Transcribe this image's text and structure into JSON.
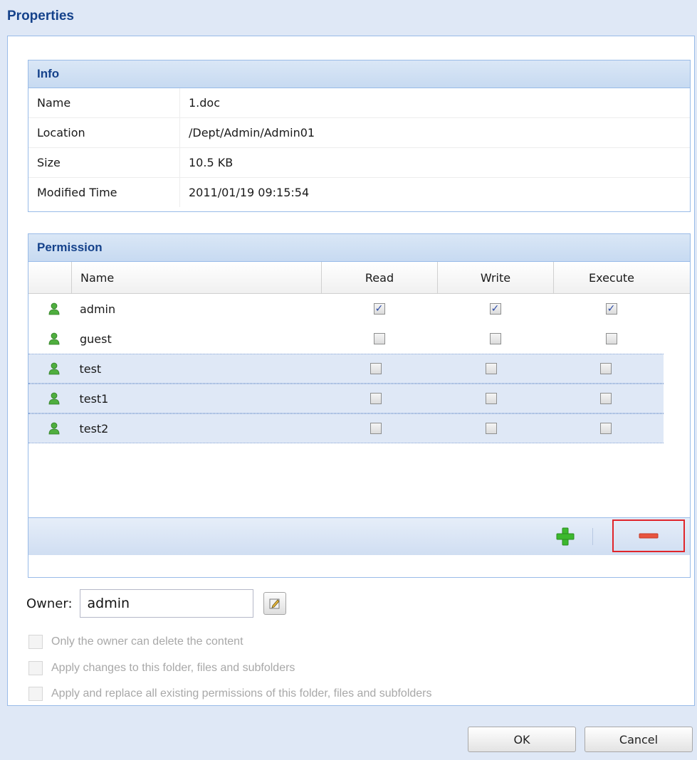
{
  "window": {
    "title": "Properties"
  },
  "info": {
    "header": "Info",
    "rows": [
      {
        "label": "Name",
        "value": "1.doc"
      },
      {
        "label": "Location",
        "value": "/Dept/Admin/Admin01"
      },
      {
        "label": "Size",
        "value": "10.5 KB"
      },
      {
        "label": "Modified Time",
        "value": "2011/01/19 09:15:54"
      }
    ]
  },
  "permission": {
    "header": "Permission",
    "columns": {
      "name": "Name",
      "read": "Read",
      "write": "Write",
      "execute": "Execute"
    },
    "rows": [
      {
        "name": "admin",
        "read": true,
        "write": true,
        "execute": true,
        "selected": false,
        "icon": "user-icon"
      },
      {
        "name": "guest",
        "read": false,
        "write": false,
        "execute": false,
        "selected": false,
        "icon": "user-icon"
      },
      {
        "name": "test",
        "read": false,
        "write": false,
        "execute": false,
        "selected": true,
        "icon": "user-icon"
      },
      {
        "name": "test1",
        "read": false,
        "write": false,
        "execute": false,
        "selected": true,
        "icon": "user-icon"
      },
      {
        "name": "test2",
        "read": false,
        "write": false,
        "execute": false,
        "selected": true,
        "icon": "user-icon"
      }
    ],
    "toolbar": {
      "add_icon": "plus-icon",
      "remove_icon": "minus-icon"
    }
  },
  "owner": {
    "label": "Owner:",
    "value": "admin",
    "edit_icon": "edit-icon"
  },
  "options": [
    {
      "label": "Only the owner can delete the content",
      "checked": false,
      "enabled": false
    },
    {
      "label": "Apply changes to this folder, files and subfolders",
      "checked": false,
      "enabled": false
    },
    {
      "label": "Apply and replace all existing permissions of this folder, files and subfolders",
      "checked": false,
      "enabled": false
    }
  ],
  "buttons": {
    "ok": "OK",
    "cancel": "Cancel"
  },
  "colors": {
    "title": "#15428b",
    "accent_border": "#99bbe8",
    "highlight": "#e0252b",
    "add_green": "#3cb82e",
    "remove_red": "#e8553f"
  }
}
